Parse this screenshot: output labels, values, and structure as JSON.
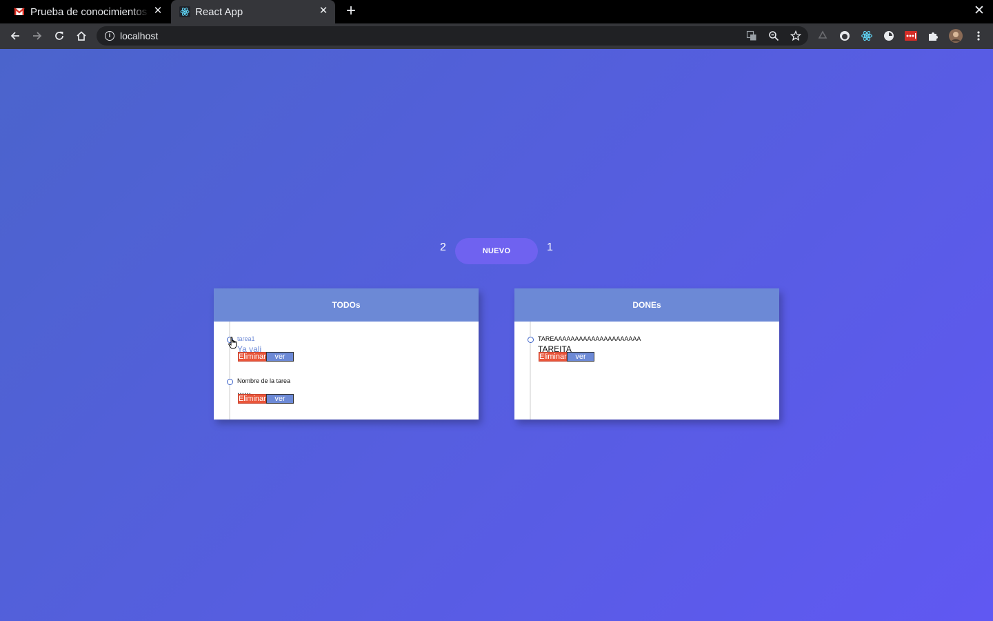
{
  "browser": {
    "tabs": [
      {
        "title": "Prueba de conocimientos t",
        "favicon": "gmail-icon"
      },
      {
        "title": "React App",
        "favicon": "react-icon"
      }
    ],
    "url": "localhost"
  },
  "app": {
    "todo_count": "2",
    "done_count": "1",
    "new_button": "NUEVO",
    "todos": {
      "title": "TODOs",
      "items": [
        {
          "name": "tarea1",
          "description": "Ya vali",
          "delete_label": "Eliminar",
          "view_label": "ver"
        },
        {
          "name": "Nombre de la tarea",
          "description": "......",
          "delete_label": "Eliminar",
          "view_label": "ver"
        }
      ]
    },
    "dones": {
      "title": "DONEs",
      "items": [
        {
          "name": "TAREAAAAAAAAAAAAAAAAAAAAA",
          "description": "TAREITA",
          "delete_label": "Eliminar",
          "view_label": "ver"
        }
      ]
    }
  },
  "colors": {
    "background_start": "#4b64cc",
    "background_end": "#6058f2",
    "panel_header": "#6c89d6",
    "delete_button": "#e9553a",
    "new_button": "#6f62f0"
  }
}
